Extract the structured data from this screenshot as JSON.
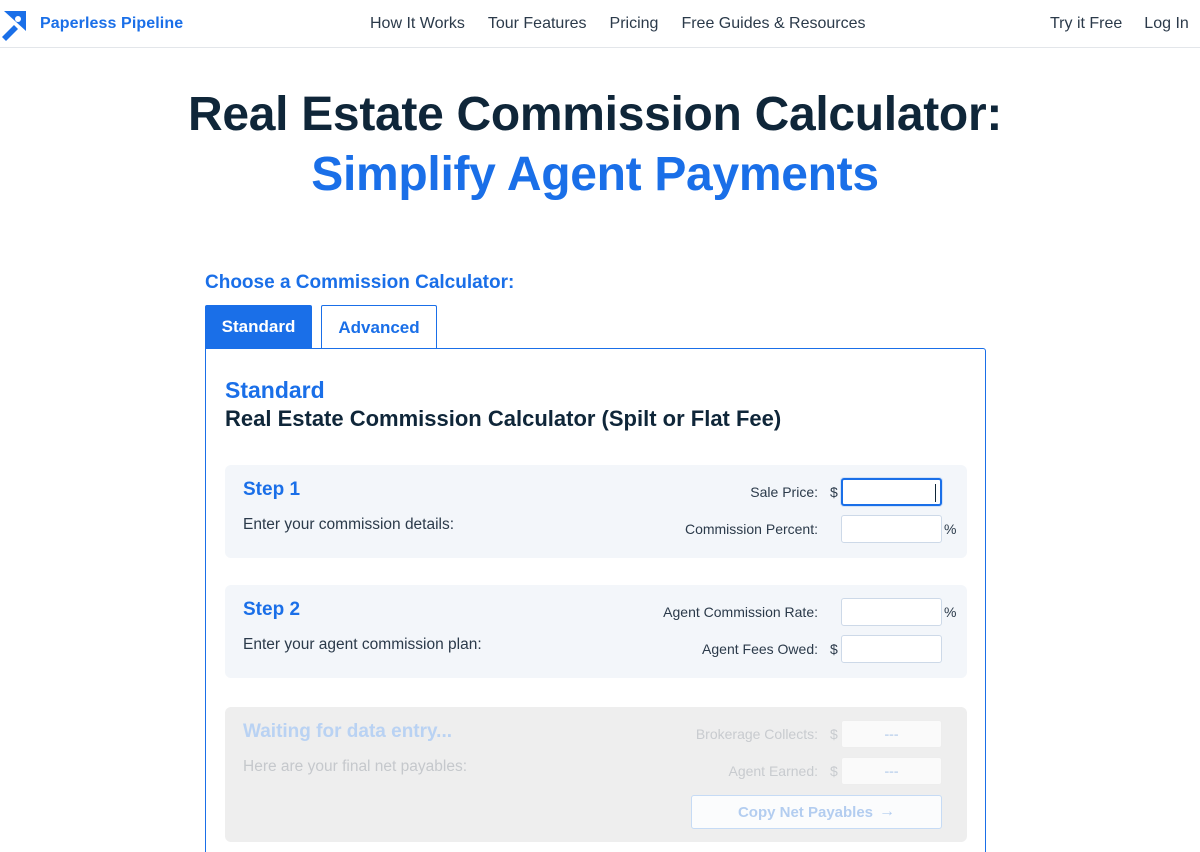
{
  "nav": {
    "brand": "Paperless Pipeline",
    "links": [
      "How It Works",
      "Tour Features",
      "Pricing",
      "Free Guides & Resources"
    ],
    "right_links": [
      "Try it Free",
      "Log In"
    ]
  },
  "hero": {
    "title": "Real Estate Commission Calculator:",
    "subtitle": "Simplify Agent Payments"
  },
  "chooser": {
    "label": "Choose a Commission Calculator:",
    "tabs": [
      "Standard",
      "Advanced"
    ],
    "active_tab": "Standard"
  },
  "panel": {
    "title": "Standard",
    "subtitle": "Real Estate Commission Calculator (Spilt or Flat Fee)",
    "step1": {
      "heading": "Step 1",
      "desc": "Enter your commission details:",
      "sale_price_label": "Sale Price:",
      "sale_price_prefix": "$",
      "sale_price_value": "",
      "commission_percent_label": "Commission Percent:",
      "commission_percent_suffix": "%",
      "commission_percent_value": ""
    },
    "step2": {
      "heading": "Step 2",
      "desc": "Enter your agent commission plan:",
      "agent_rate_label": "Agent Commission Rate:",
      "agent_rate_suffix": "%",
      "agent_rate_value": "",
      "agent_fees_label": "Agent Fees Owed:",
      "agent_fees_prefix": "$",
      "agent_fees_value": ""
    },
    "result": {
      "heading": "Waiting for data entry...",
      "desc": "Here are your final net payables:",
      "brokerage_label": "Brokerage Collects:",
      "brokerage_prefix": "$",
      "brokerage_value": "---",
      "agent_earned_label": "Agent Earned:",
      "agent_earned_prefix": "$",
      "agent_earned_value": "---",
      "copy_button": "Copy Net Payables",
      "copy_arrow": "→"
    }
  },
  "colors": {
    "brand_blue": "#1a6fe8",
    "heading_dark": "#0f2639",
    "step_bg": "#f3f6fa",
    "disabled_bg": "#eeeeee"
  }
}
